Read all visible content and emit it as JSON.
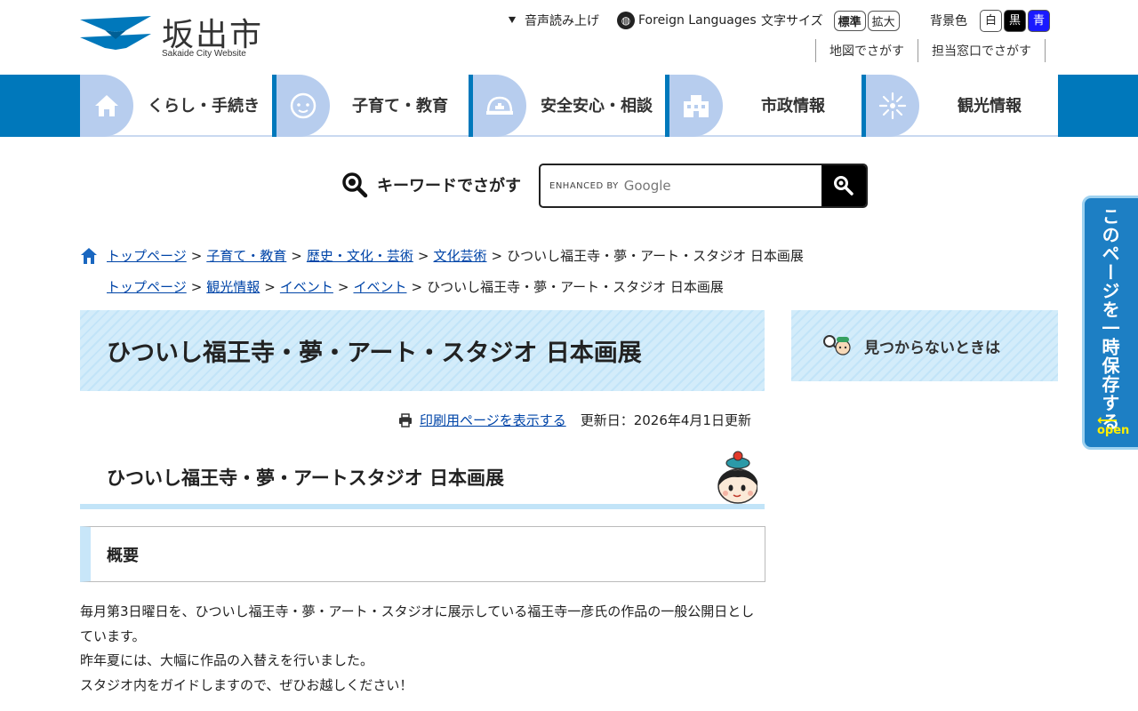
{
  "header": {
    "logo_title": "坂出市",
    "logo_sub": "Sakaide City Website",
    "voice_label": "音声読み上げ",
    "lang_label": "Foreign Languages",
    "font_size_label": "文字サイズ",
    "font_std": "標準",
    "font_large": "拡大",
    "bg_label": "背景色",
    "bg_white": "白",
    "bg_black": "黒",
    "bg_blue": "青",
    "map_search": "地図でさがす",
    "dept_search": "担当窓口でさがす"
  },
  "nav": [
    {
      "label": "くらし・手続き",
      "icon": "house-icon"
    },
    {
      "label": "子育て・教育",
      "icon": "baby-icon"
    },
    {
      "label": "安全安心・相談",
      "icon": "helmet-icon"
    },
    {
      "label": "市政情報",
      "icon": "building-icon"
    },
    {
      "label": "観光情報",
      "icon": "firework-icon"
    }
  ],
  "search": {
    "label": "キーワードでさがす",
    "enhanced": "ENHANCED BY",
    "google": "Google"
  },
  "sidetab": {
    "text": "このページを一時保存する",
    "open": "open"
  },
  "breadcrumb1": {
    "items": [
      "トップページ",
      "子育て・教育",
      "歴史・文化・芸術",
      "文化芸術"
    ],
    "current": "ひついし福王寺・夢・アート・スタジオ 日本画展"
  },
  "breadcrumb2": {
    "items": [
      "トップページ",
      "観光情報",
      "イベント",
      "イベント"
    ],
    "current": "ひついし福王寺・夢・アート・スタジオ 日本画展"
  },
  "page": {
    "title": "ひついし福王寺・夢・アート・スタジオ 日本画展",
    "print_link": "印刷用ページを表示する",
    "updated": "更新日：2026年4月1日更新",
    "h2": "ひついし福王寺・夢・アートスタジオ 日本画展",
    "h3": "概要",
    "body": [
      "毎月第3日曜日を、ひついし福王寺・夢・アート・スタジオに展示している福王寺一彦氏の作品の一般公開日としています。",
      "昨年夏には、大幅に作品の入替えを行いました。",
      "スタジオ内をガイドしますので、ぜひお越しください！"
    ]
  },
  "sidebar": {
    "help": "見つからないときは"
  },
  "colors": {
    "brand_blue": "#0078bb",
    "nav_icon_bg": "#b7cdee",
    "title_bg": "#d3ecfa",
    "link": "#0045a8"
  }
}
